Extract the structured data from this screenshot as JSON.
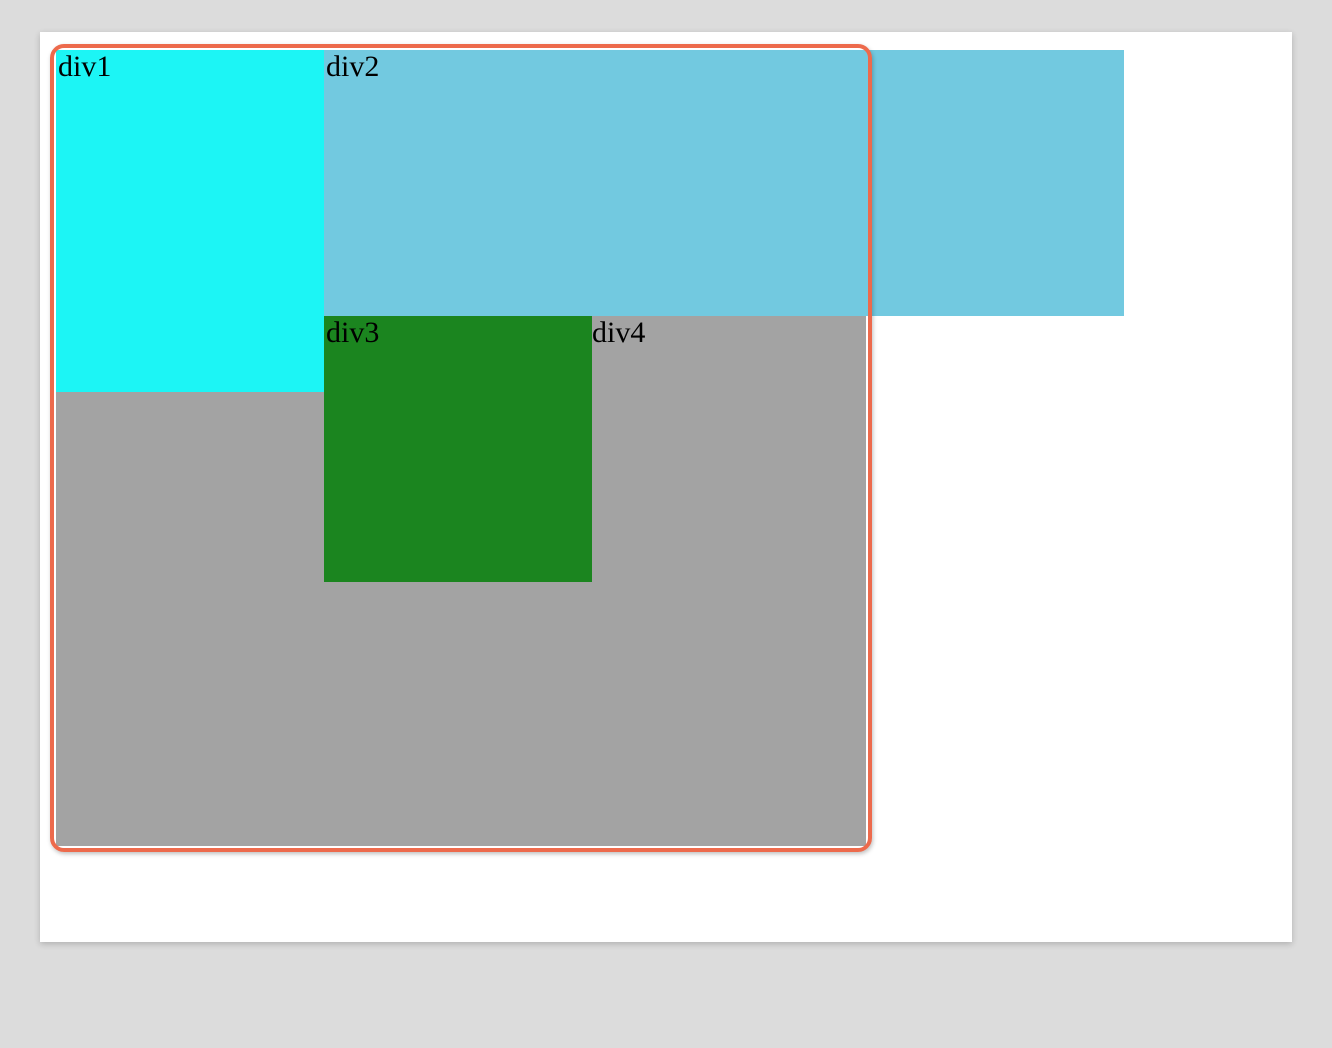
{
  "boxes": {
    "div1": {
      "label": "div1",
      "color": "#1cf5f5"
    },
    "div2": {
      "label": "div2",
      "color": "#72c9e0"
    },
    "div3": {
      "label": "div3",
      "color": "#1b851f"
    },
    "div4": {
      "label": "div4",
      "color": "#a3a3a3"
    }
  },
  "container": {
    "border_color": "#ed6a4c"
  }
}
